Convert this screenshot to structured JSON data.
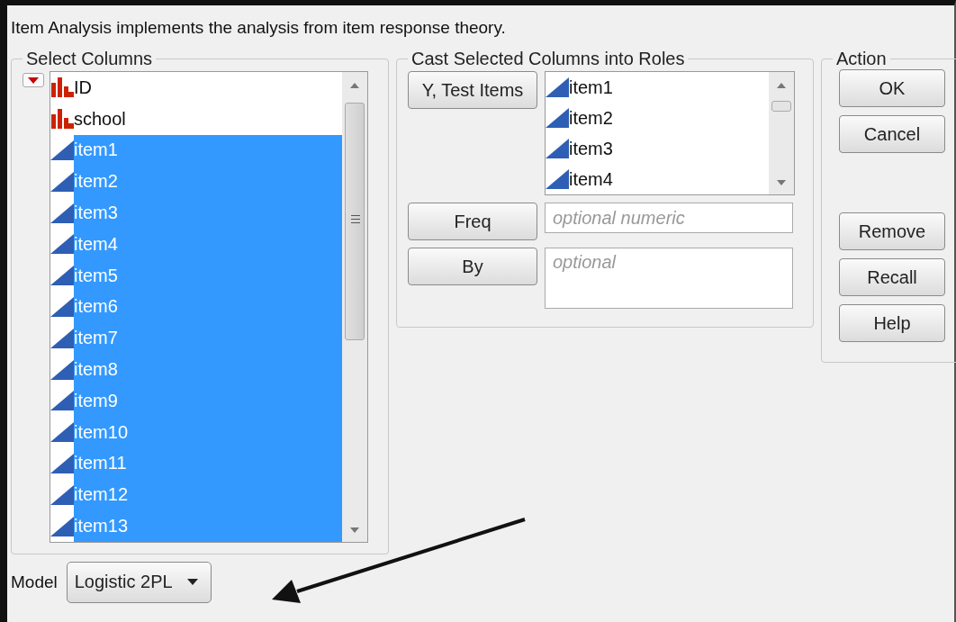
{
  "description": "Item Analysis implements the analysis from item response theory.",
  "select_columns": {
    "title": "Select Columns",
    "columns": [
      {
        "name": "ID",
        "kind": "nominal",
        "selected": false
      },
      {
        "name": "school",
        "kind": "nominal",
        "selected": false
      },
      {
        "name": "item1",
        "kind": "continuous",
        "selected": true
      },
      {
        "name": "item2",
        "kind": "continuous",
        "selected": true
      },
      {
        "name": "item3",
        "kind": "continuous",
        "selected": true
      },
      {
        "name": "item4",
        "kind": "continuous",
        "selected": true
      },
      {
        "name": "item5",
        "kind": "continuous",
        "selected": true
      },
      {
        "name": "item6",
        "kind": "continuous",
        "selected": true
      },
      {
        "name": "item7",
        "kind": "continuous",
        "selected": true
      },
      {
        "name": "item8",
        "kind": "continuous",
        "selected": true
      },
      {
        "name": "item9",
        "kind": "continuous",
        "selected": true
      },
      {
        "name": "item10",
        "kind": "continuous",
        "selected": true
      },
      {
        "name": "item11",
        "kind": "continuous",
        "selected": true
      },
      {
        "name": "item12",
        "kind": "continuous",
        "selected": true
      },
      {
        "name": "item13",
        "kind": "continuous",
        "selected": true
      }
    ]
  },
  "roles": {
    "title": "Cast Selected Columns into Roles",
    "rows": [
      {
        "kind": "list",
        "button": "Y, Test Items",
        "items": [
          {
            "name": "item1",
            "kind": "continuous"
          },
          {
            "name": "item2",
            "kind": "continuous"
          },
          {
            "name": "item3",
            "kind": "continuous"
          },
          {
            "name": "item4",
            "kind": "continuous"
          }
        ]
      },
      {
        "kind": "field",
        "button": "Freq",
        "placeholder": "optional numeric"
      },
      {
        "kind": "area",
        "button": "By",
        "placeholder": "optional"
      }
    ]
  },
  "action": {
    "title": "Action",
    "buttons": [
      {
        "label": "OK",
        "kind": "button"
      },
      {
        "label": "Cancel",
        "kind": "button"
      },
      {
        "kind": "spacer"
      },
      {
        "label": "Remove",
        "kind": "button"
      },
      {
        "label": "Recall",
        "kind": "button"
      },
      {
        "label": "Help",
        "kind": "button"
      }
    ]
  },
  "model": {
    "label": "Model",
    "value": "Logistic 2PL"
  }
}
